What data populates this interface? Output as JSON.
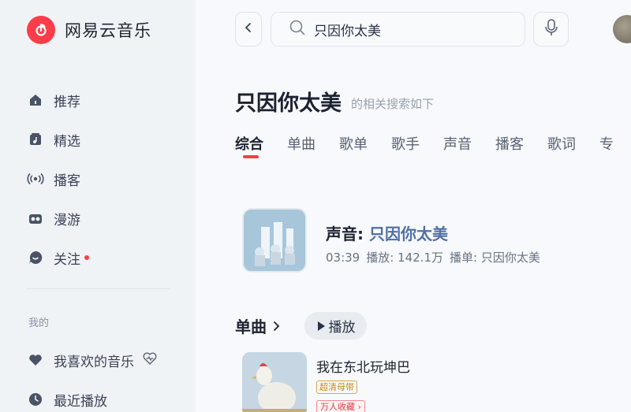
{
  "app": {
    "name": "网易云音乐"
  },
  "sidebar": {
    "items": [
      {
        "label": "推荐",
        "icon": "home-icon"
      },
      {
        "label": "精选",
        "icon": "music-note-icon"
      },
      {
        "label": "播客",
        "icon": "podcast-icon"
      },
      {
        "label": "漫游",
        "icon": "radio-icon"
      },
      {
        "label": "关注",
        "icon": "chat-bubble-icon",
        "has_dot": true
      }
    ],
    "section_label": "我的",
    "my_items": [
      {
        "label": "我喜欢的音乐",
        "icon": "heart-icon"
      },
      {
        "label": "最近播放",
        "icon": "clock-icon"
      }
    ]
  },
  "search": {
    "value": "只因你太美"
  },
  "header": {
    "title": "只因你太美",
    "subtitle": "的相关搜索如下"
  },
  "tabs": [
    "综合",
    "单曲",
    "歌单",
    "歌手",
    "声音",
    "播客",
    "歌词",
    "专"
  ],
  "voice_result": {
    "prefix": "声音: ",
    "title": "只因你太美",
    "duration": "03:39",
    "plays": "播放: 142.1万",
    "playlist": "播单: 只因你太美"
  },
  "singles": {
    "heading": "单曲",
    "play_label": "播放",
    "song_title": "我在东北玩坤巴",
    "tag_hq": "超清母带",
    "tag_fav": "万人收藏"
  },
  "colors": {
    "accent": "#fc3d49",
    "highlight": "#4f6fa6"
  }
}
